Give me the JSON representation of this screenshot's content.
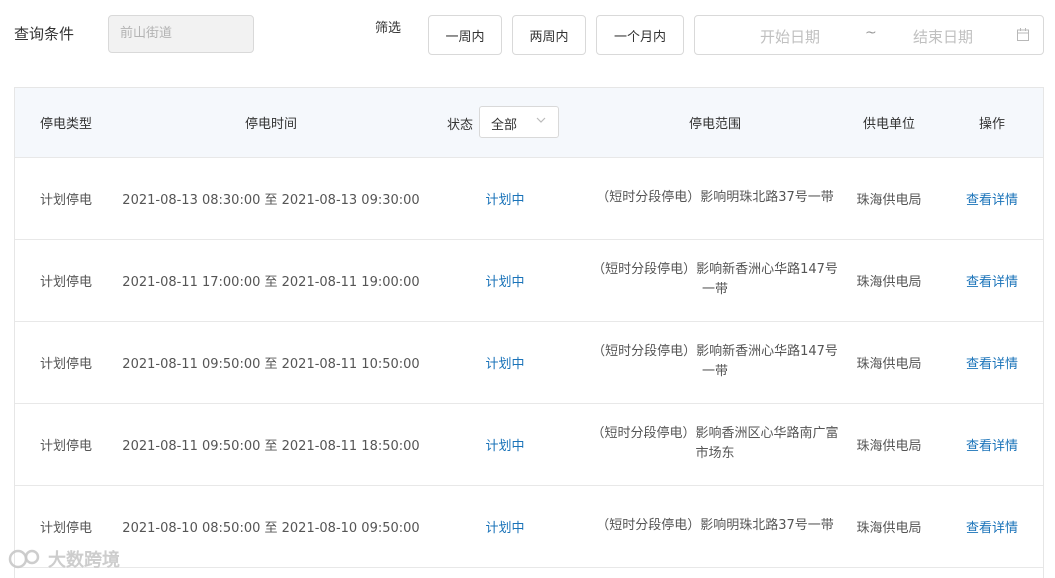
{
  "filters": {
    "query_label": "查询条件",
    "query_value": "前山街道",
    "filter_label": "筛选",
    "buttons": [
      "一周内",
      "两周内",
      "一个月内"
    ],
    "date_start_placeholder": "开始日期",
    "date_separator": "~",
    "date_end_placeholder": "结束日期"
  },
  "table": {
    "headers": {
      "type": "停电类型",
      "time": "停电时间",
      "status_label": "状态",
      "status_value": "全部",
      "range": "停电范围",
      "unit": "供电单位",
      "op": "操作"
    },
    "rows": [
      {
        "type": "计划停电",
        "time": "2021-08-13 08:30:00 至 2021-08-13 09:30:00",
        "status": "计划中",
        "range": "（短时分段停电）影响明珠北路37号一带",
        "unit": "珠海供电局",
        "op": "查看详情"
      },
      {
        "type": "计划停电",
        "time": "2021-08-11 17:00:00 至 2021-08-11 19:00:00",
        "status": "计划中",
        "range": "（短时分段停电）影响新香洲心华路147号一带",
        "unit": "珠海供电局",
        "op": "查看详情"
      },
      {
        "type": "计划停电",
        "time": "2021-08-11 09:50:00 至 2021-08-11 10:50:00",
        "status": "计划中",
        "range": "（短时分段停电）影响新香洲心华路147号一带",
        "unit": "珠海供电局",
        "op": "查看详情"
      },
      {
        "type": "计划停电",
        "time": "2021-08-11 09:50:00 至 2021-08-11 18:50:00",
        "status": "计划中",
        "range": "（短时分段停电）影响香洲区心华路南广富市场东",
        "unit": "珠海供电局",
        "op": "查看详情"
      },
      {
        "type": "计划停电",
        "time": "2021-08-10 08:50:00 至 2021-08-10 09:50:00",
        "status": "计划中",
        "range": "（短时分段停电）影响明珠北路37号一带",
        "unit": "珠海供电局",
        "op": "查看详情"
      }
    ]
  },
  "watermark": "大数跨境",
  "colors": {
    "link": "#1a73b9",
    "header_bg": "#f5f8fc",
    "border": "#d9d9d9"
  }
}
